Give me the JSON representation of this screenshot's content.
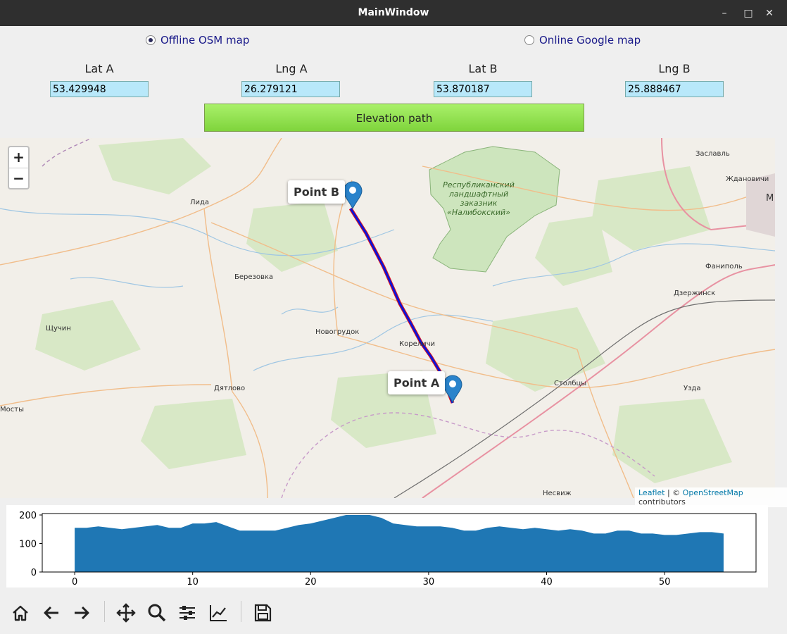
{
  "window": {
    "title": "MainWindow"
  },
  "map_source": {
    "offline_label": "Offline OSM map",
    "online_label": "Online Google map",
    "selected": "offline"
  },
  "fields": {
    "lat_a": {
      "label": "Lat A",
      "value": "53.429948"
    },
    "lng_a": {
      "label": "Lng A",
      "value": "26.279121"
    },
    "lat_b": {
      "label": "Lat B",
      "value": "53.870187"
    },
    "lng_b": {
      "label": "Lng B",
      "value": "25.888467"
    }
  },
  "elevation_button": {
    "label": "Elevation path"
  },
  "map": {
    "zoom_in": "+",
    "zoom_out": "−",
    "marker_a": "Point A",
    "marker_b": "Point B",
    "attribution": {
      "leaflet": "Leaflet",
      "sep": " | © ",
      "osm": "OpenStreetMap",
      "suffix": " contributors"
    },
    "places": {
      "lida": "Лида",
      "berezovka": "Березовка",
      "shchuchin": "Щучин",
      "novogrudok": "Новогрудок",
      "korelichi": "Кореличи",
      "dyatlovo": "Дятлово",
      "mosty": "Мосты",
      "stolbtsy": "Столбцы",
      "uzda": "Узда",
      "nesvizh": "Несвиж",
      "zaslavl": "Заславль",
      "zhdanovichi": "Ждановичи",
      "fanipol": "Фаниполь",
      "dzerzhinsk": "Дзержинск",
      "reserve_line1": "Республиканский",
      "reserve_line2": "ландшафтный",
      "reserve_line3": "заказник",
      "reserve_line4": "«Налибокский»",
      "edge_m": "М"
    },
    "colors": {
      "path": "#0a14d8",
      "path_shadow": "#e0141e",
      "marker": "#2a83cb",
      "reserve": "#cde5bd"
    }
  },
  "chart_data": {
    "type": "area",
    "x": [
      0,
      1,
      2,
      3,
      4,
      5,
      6,
      7,
      8,
      9,
      10,
      11,
      12,
      13,
      14,
      15,
      16,
      17,
      18,
      19,
      20,
      21,
      22,
      23,
      24,
      25,
      26,
      27,
      28,
      29,
      30,
      31,
      32,
      33,
      34,
      35,
      36,
      37,
      38,
      39,
      40,
      41,
      42,
      43,
      44,
      45,
      46,
      47,
      48,
      49,
      50,
      51,
      52,
      53,
      54,
      55
    ],
    "y": [
      155,
      155,
      160,
      155,
      150,
      155,
      160,
      165,
      155,
      155,
      170,
      170,
      175,
      160,
      145,
      145,
      145,
      145,
      155,
      165,
      170,
      180,
      190,
      200,
      200,
      200,
      190,
      170,
      165,
      160,
      160,
      160,
      155,
      145,
      145,
      155,
      160,
      155,
      150,
      155,
      150,
      145,
      150,
      145,
      135,
      135,
      145,
      145,
      135,
      135,
      130,
      130,
      135,
      140,
      140,
      135
    ],
    "xticks": [
      "0",
      "10",
      "20",
      "30",
      "40",
      "50"
    ],
    "yticks": [
      "0",
      "100",
      "200"
    ],
    "xlim": [
      -2.75,
      57.75
    ],
    "ylim": [
      0,
      205
    ],
    "color": "#1f77b4"
  },
  "nav_toolbar": {
    "icons": [
      "home-icon",
      "back-icon",
      "forward-icon",
      "pan-icon",
      "zoom-icon",
      "subplots-icon",
      "customize-icon",
      "save-icon"
    ]
  }
}
